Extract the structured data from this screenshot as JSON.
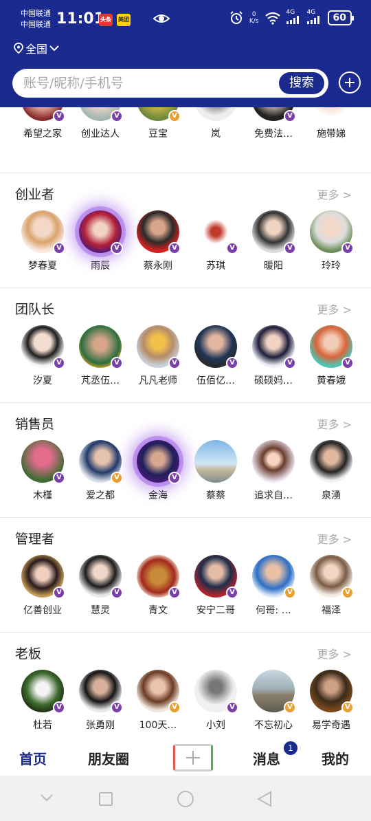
{
  "status_bar": {
    "carrier1": "中国联通",
    "carrier2": "中国联通",
    "time": "11:01",
    "app_badges": [
      "头条",
      "美团"
    ],
    "speed_value": "0",
    "speed_unit": "K/s",
    "net1": "4G",
    "net2": "4G",
    "battery": "60"
  },
  "header": {
    "location": "全国",
    "search_placeholder": "账号/昵称/手机号",
    "search_button": "搜索"
  },
  "colors": {
    "primary": "#1b2a8f",
    "v_purple": "#7b3fa8",
    "v_gold": "#e8a030"
  },
  "top_row": {
    "people": [
      {
        "name": "希望之家",
        "badge": "purple"
      },
      {
        "name": "创业达人",
        "badge": "purple"
      },
      {
        "name": "豆宝",
        "badge": "gold"
      },
      {
        "name": "岚",
        "badge": "none"
      },
      {
        "name": "免费法…",
        "badge": "purple"
      },
      {
        "name": "施带娣",
        "badge": "none"
      }
    ]
  },
  "sections": [
    {
      "title": "创业者",
      "more": "更多 >",
      "people": [
        {
          "name": "梦春夏",
          "badge": "purple"
        },
        {
          "name": "雨辰",
          "badge": "purple"
        },
        {
          "name": "蔡永刚",
          "badge": "purple"
        },
        {
          "name": "苏琪",
          "badge": "purple"
        },
        {
          "name": "暖阳",
          "badge": "purple"
        },
        {
          "name": "玲玲",
          "badge": "purple"
        }
      ]
    },
    {
      "title": "团队长",
      "more": "更多 >",
      "people": [
        {
          "name": "汐夏",
          "badge": "purple"
        },
        {
          "name": "芃丞伍…",
          "badge": "purple"
        },
        {
          "name": "凡凡老师",
          "badge": "purple"
        },
        {
          "name": "伍佰亿…",
          "badge": "purple"
        },
        {
          "name": "硕硕妈…",
          "badge": "purple"
        },
        {
          "name": "黄春娥",
          "badge": "purple"
        }
      ]
    },
    {
      "title": "销售员",
      "more": "更多 >",
      "people": [
        {
          "name": "木槿",
          "badge": "purple"
        },
        {
          "name": "爱之都",
          "badge": "gold"
        },
        {
          "name": "金海",
          "badge": "purple"
        },
        {
          "name": "蔡蔡",
          "badge": "none"
        },
        {
          "name": "追求自…",
          "badge": "none"
        },
        {
          "name": "泉湧",
          "badge": "none"
        }
      ]
    },
    {
      "title": "管理者",
      "more": "更多 >",
      "people": [
        {
          "name": "亿善创业",
          "badge": "purple"
        },
        {
          "name": "慧灵",
          "badge": "purple"
        },
        {
          "name": "青文",
          "badge": "purple"
        },
        {
          "name": "安宁二哥",
          "badge": "purple"
        },
        {
          "name": "何哥: …",
          "badge": "gold"
        },
        {
          "name": "福泽",
          "badge": "gold"
        }
      ]
    },
    {
      "title": "老板",
      "more": "更多 >",
      "people": [
        {
          "name": "杜若",
          "badge": "purple"
        },
        {
          "name": "张勇刚",
          "badge": "purple"
        },
        {
          "name": "100天…",
          "badge": "gold"
        },
        {
          "name": "小刘",
          "badge": "purple"
        },
        {
          "name": "不忘初心",
          "badge": "gold"
        },
        {
          "name": "易学奇遇",
          "badge": "gold"
        }
      ]
    }
  ],
  "bottom_nav": {
    "home": "首页",
    "moments": "朋友圈",
    "messages": "消息",
    "messages_badge": "1",
    "mine": "我的"
  }
}
